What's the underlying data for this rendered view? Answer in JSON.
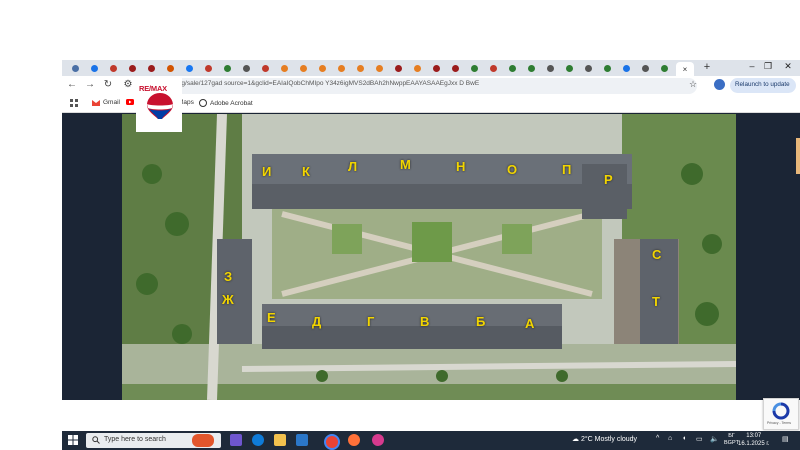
{
  "browser": {
    "new_tab": "+",
    "active_tab_close": "×",
    "window_controls": [
      "⌄",
      "–",
      "❐",
      "✕"
    ],
    "tab_icon_colors": [
      "#4a6fa5",
      "#1a73e8",
      "#c0392b",
      "#9b1c1c",
      "#9b1c1c",
      "#d35400",
      "#1877f2",
      "#c0392b",
      "#2e7d32",
      "#555555",
      "#c0392b",
      "#e67e22",
      "#e67e22",
      "#e67e22",
      "#e67e22",
      "#e67e22",
      "#e67e22",
      "#9b1c1c",
      "#e67e22",
      "#9b1c1c",
      "#9b1c1c",
      "#2e7d32",
      "#c0392b",
      "#2e7d32",
      "#2e7d32",
      "#555555",
      "#2e7d32",
      "#555555",
      "#2e7d32",
      "#1a73e8",
      "#555555",
      "#2e7d32"
    ],
    "url": "/bg/sale/127gad source=1&gclid=EAIaIQobChMIpo Y34z6igMVS2dBAh2hNwppEAAYASAAEgJxx D BwE",
    "relaunch_label": "Relaunch to update",
    "bookmarks": [
      {
        "label": "Gmail",
        "icon": "gmail-icon"
      },
      {
        "label": "",
        "icon": "youtube-icon"
      },
      {
        "label": "Maps",
        "icon": "maps-icon"
      },
      {
        "label": "Adobe Acrobat",
        "icon": "acrobat-icon"
      }
    ],
    "nav": {
      "back": "←",
      "forward": "→",
      "reload": "↻",
      "site_info": "⚙"
    }
  },
  "logo": {
    "text": "RE/MAX",
    "colors": {
      "red": "#c8102e",
      "blue": "#003da5"
    }
  },
  "site_plan": {
    "building_labels": [
      "И",
      "К",
      "Л",
      "М",
      "Н",
      "О",
      "П",
      "Р",
      "С",
      "Т",
      "З",
      "Ж",
      "Е",
      "Д",
      "Г",
      "В",
      "Б",
      "А"
    ]
  },
  "taskbar": {
    "search_placeholder": "Type here to search",
    "weather": "2°C  Mostly cloudy",
    "language": [
      "БГ",
      "BGPT"
    ],
    "time": "13:07",
    "date": "16.1.2025 г."
  },
  "recaptcha": {
    "text": "Privacy - Terms"
  }
}
